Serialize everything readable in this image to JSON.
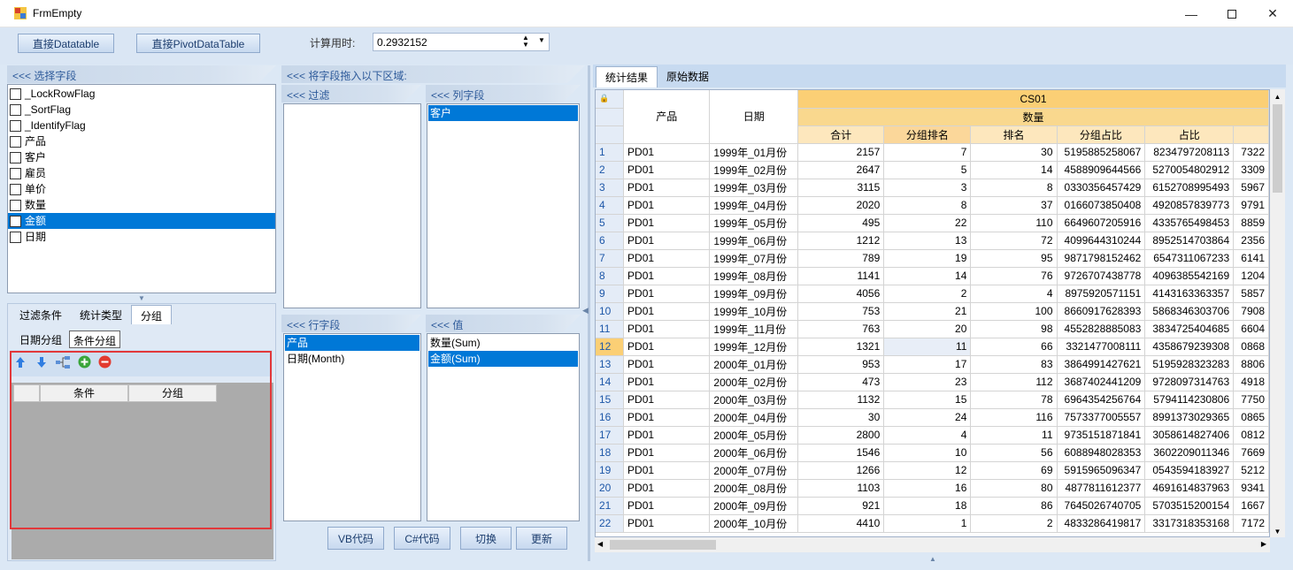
{
  "window": {
    "title": "FrmEmpty"
  },
  "toolbar": {
    "btn_datatable": "直接Datatable",
    "btn_pivot": "直接PivotDataTable",
    "calc_time_label": "计算用时:",
    "calc_time_value": "0.2932152"
  },
  "fields": {
    "header": "<<< 选择字段",
    "items": [
      "_LockRowFlag",
      "_SortFlag",
      "_IdentifyFlag",
      "产品",
      "客户",
      "雇员",
      "单价",
      "数量",
      "金额",
      "日期"
    ],
    "selected_index": 8
  },
  "left_tabs": [
    "过滤条件",
    "统计类型",
    "分组"
  ],
  "sub_tabs": [
    "日期分组",
    "条件分组"
  ],
  "cond_grid": {
    "col1": "条件",
    "col2": "分组"
  },
  "middle": {
    "drag_header": "<<< 将字段拖入以下区域:",
    "filter_header": "<<< 过滤",
    "column_header": "<<< 列字段",
    "column_items": [
      "客户"
    ],
    "row_header": "<<< 行字段",
    "row_items": [
      "产品",
      "日期(Month)"
    ],
    "value_header": "<<< 值",
    "value_items": [
      "数量(Sum)",
      "金额(Sum)"
    ]
  },
  "bottom_buttons": [
    "VB代码",
    "C#代码",
    "切换",
    "更新"
  ],
  "right_tabs": [
    "统计结果",
    "原始数据"
  ],
  "table": {
    "h_product": "产品",
    "h_date": "日期",
    "h_cs": "CS01",
    "h_qty": "数量",
    "cols": [
      "合计",
      "分组排名",
      "排名",
      "分组占比",
      "占比",
      ""
    ],
    "rows": [
      [
        "1",
        "PD01",
        "1999年_01月份",
        "2157",
        "7",
        "30",
        "5195885258067",
        "8234797208113",
        "7322"
      ],
      [
        "2",
        "PD01",
        "1999年_02月份",
        "2647",
        "5",
        "14",
        "4588909644566",
        "5270054802912",
        "3309"
      ],
      [
        "3",
        "PD01",
        "1999年_03月份",
        "3115",
        "3",
        "8",
        "0330356457429",
        "6152708995493",
        "5967"
      ],
      [
        "4",
        "PD01",
        "1999年_04月份",
        "2020",
        "8",
        "37",
        "0166073850408",
        "4920857839773",
        "9791"
      ],
      [
        "5",
        "PD01",
        "1999年_05月份",
        "495",
        "22",
        "110",
        "6649607205916",
        "4335765498453",
        "8859"
      ],
      [
        "6",
        "PD01",
        "1999年_06月份",
        "1212",
        "13",
        "72",
        "4099644310244",
        "8952514703864",
        "2356"
      ],
      [
        "7",
        "PD01",
        "1999年_07月份",
        "789",
        "19",
        "95",
        "9871798152462",
        "6547311067233",
        "6141"
      ],
      [
        "8",
        "PD01",
        "1999年_08月份",
        "1141",
        "14",
        "76",
        "9726707438778",
        "4096385542169",
        "1204"
      ],
      [
        "9",
        "PD01",
        "1999年_09月份",
        "4056",
        "2",
        "4",
        "8975920571151",
        "4143163363357",
        "5857"
      ],
      [
        "10",
        "PD01",
        "1999年_10月份",
        "753",
        "21",
        "100",
        "8660917628393",
        "5868346303706",
        "7908"
      ],
      [
        "11",
        "PD01",
        "1999年_11月份",
        "763",
        "20",
        "98",
        "4552828885083",
        "3834725404685",
        "6604"
      ],
      [
        "12",
        "PD01",
        "1999年_12月份",
        "1321",
        "11",
        "66",
        "3321477008111",
        "4358679239308",
        "0868"
      ],
      [
        "13",
        "PD01",
        "2000年_01月份",
        "953",
        "17",
        "83",
        "3864991427621",
        "5195928323283",
        "8806"
      ],
      [
        "14",
        "PD01",
        "2000年_02月份",
        "473",
        "23",
        "112",
        "3687402441209",
        "9728097314763",
        "4918"
      ],
      [
        "15",
        "PD01",
        "2000年_03月份",
        "1132",
        "15",
        "78",
        "6964354256764",
        "5794114230806",
        "7750"
      ],
      [
        "16",
        "PD01",
        "2000年_04月份",
        "30",
        "24",
        "116",
        "7573377005557",
        "8991373029365",
        "0865"
      ],
      [
        "17",
        "PD01",
        "2000年_05月份",
        "2800",
        "4",
        "11",
        "9735151871841",
        "3058614827406",
        "0812"
      ],
      [
        "18",
        "PD01",
        "2000年_06月份",
        "1546",
        "10",
        "56",
        "6088948028353",
        "3602209011346",
        "7669"
      ],
      [
        "19",
        "PD01",
        "2000年_07月份",
        "1266",
        "12",
        "69",
        "5915965096347",
        "0543594183927",
        "5212"
      ],
      [
        "20",
        "PD01",
        "2000年_08月份",
        "1103",
        "16",
        "80",
        "4877811612377",
        "4691614837963",
        "9341"
      ],
      [
        "21",
        "PD01",
        "2000年_09月份",
        "921",
        "18",
        "86",
        "7645026740705",
        "5703515200154",
        "1667"
      ],
      [
        "22",
        "PD01",
        "2000年_10月份",
        "4410",
        "1",
        "2",
        "4833286419817",
        "3317318353168",
        "7172"
      ]
    ]
  }
}
